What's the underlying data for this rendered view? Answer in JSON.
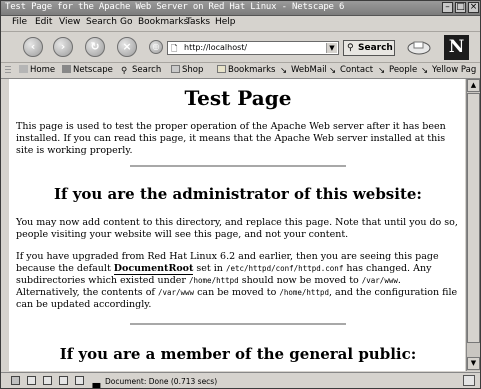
{
  "window": {
    "title": "Test Page for the Apache Web Server on Red Hat Linux - Netscape 6",
    "controls": [
      "minimize",
      "maximize",
      "close"
    ]
  },
  "menu": {
    "items": [
      {
        "label": "File"
      },
      {
        "label": "Edit"
      },
      {
        "label": "View"
      },
      {
        "label": "Search"
      },
      {
        "label": "Go"
      },
      {
        "label": "Bookmarks"
      },
      {
        "label": "Tasks"
      },
      {
        "label": "Help"
      }
    ]
  },
  "nav": {
    "back_icon": "back-arrow-icon",
    "forward_icon": "forward-arrow-icon",
    "reload_icon": "reload-icon",
    "stop_icon": "stop-icon",
    "url": "http://localhost/",
    "search_label": "Search",
    "logo": "N"
  },
  "personal_toolbar": {
    "items": [
      {
        "label": "Home"
      },
      {
        "label": "Netscape"
      },
      {
        "label": "Search"
      },
      {
        "label": "Shop"
      },
      {
        "label": "Bookmarks"
      },
      {
        "label": "WebMail"
      },
      {
        "label": "Contact"
      },
      {
        "label": "People"
      },
      {
        "label": "Yellow Pag"
      }
    ]
  },
  "page": {
    "title": "Test Page",
    "intro": "This page is used to test the proper operation of the Apache Web server after it has been installed. If you can read this page, it means that the Apache Web server installed at this site is working properly.",
    "admin_heading": "If you are the administrator of this website:",
    "admin_p1": "You may now add content to this directory, and replace this page. Note that until you do so, people visiting your website will see this page, and not your content.",
    "admin_p2": {
      "t1": "If you have upgraded from Red Hat Linux 6.2 and earlier, then you are seeing this page because the default ",
      "kw": "DocumentRoot",
      "t2": " set in ",
      "c1": "/etc/httpd/conf/httpd.conf",
      "t3": " has changed. Any subdirectories which existed under ",
      "c2": "/home/httpd",
      "t4": " should now be moved to ",
      "c3": "/var/www",
      "t5": ". Alternatively, the contents of ",
      "c4": "/var/www",
      "t6": " can be moved to ",
      "c5": "/home/httpd",
      "t7": ", and the configuration file can be updated accordingly."
    },
    "public_heading": "If you are a member of the general public:"
  },
  "status": {
    "text": "Document: Done (0.713 secs)"
  }
}
